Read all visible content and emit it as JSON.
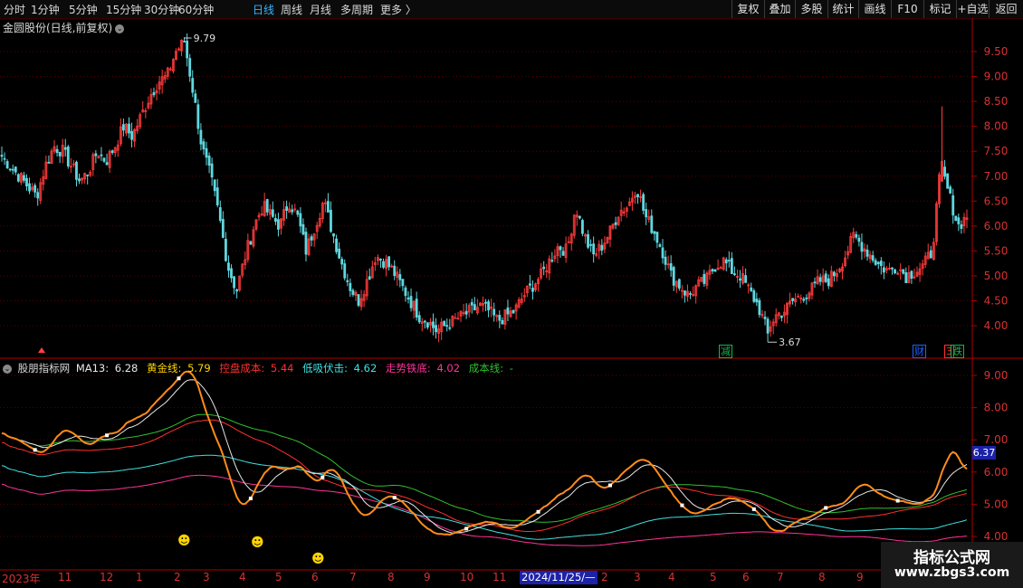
{
  "toolbar": {
    "periods": [
      "分时",
      "1分钟",
      "5分钟",
      "15分钟",
      "30分钟",
      "60分钟",
      "日线",
      "周线",
      "月线",
      "多周期",
      "更多"
    ],
    "active_period": "日线",
    "more_arrow": "〉",
    "buttons": [
      "复权",
      "叠加",
      "多股",
      "统计",
      "画线",
      "F10",
      "标记",
      "+自选",
      "返回"
    ]
  },
  "stock": {
    "title": "金圆股份(日线,前复权)",
    "max_label": "9.79",
    "min_label": "3.67",
    "price_ticks": [
      "9.50",
      "9.00",
      "8.50",
      "8.00",
      "7.50",
      "7.00",
      "6.50",
      "6.00",
      "5.50",
      "5.00",
      "4.50",
      "4.00"
    ],
    "signals": [
      {
        "text": "减",
        "color": "#0fb84a"
      },
      {
        "text": "财",
        "color": "#2060ff"
      },
      {
        "text": "3",
        "color": "#ff3030"
      },
      {
        "text": "跌",
        "color": "#0fb84a"
      }
    ]
  },
  "indicator": {
    "name": "股朋指标网",
    "ma13": {
      "label": "MA13: ",
      "value": "6.28",
      "color": "#e8e8e8"
    },
    "gold": {
      "label": "黄金线: ",
      "value": "5.79",
      "color": "#ffd400"
    },
    "control": {
      "label": "控盘成本: ",
      "value": "5.44",
      "color": "#ff3030"
    },
    "low_buy": {
      "label": "低吸伏击: ",
      "value": "4.62",
      "color": "#40e0e0"
    },
    "bottom": {
      "label": "走势铁底: ",
      "value": "4.02",
      "color": "#ff3399"
    },
    "cost": {
      "label": "成本线: ",
      "value": "-",
      "color": "#30c030"
    },
    "ticks": [
      "9.00",
      "8.00",
      "7.00",
      "6.00",
      "5.00",
      "4.00"
    ],
    "current_value": "6.37",
    "smile_symbol": "☻"
  },
  "date_axis": {
    "labels": [
      "2023年",
      "11",
      "12",
      "1",
      "2",
      "3",
      "4",
      "5",
      "6",
      "7",
      "8",
      "9",
      "10",
      "11",
      "12",
      "2",
      "3",
      "4",
      "5",
      "6",
      "7",
      "8",
      "9",
      "10",
      "11"
    ],
    "cursor_label": "2024/11/25/—"
  },
  "watermark": {
    "title": "指标公式网",
    "url": "www.zbgs3.com"
  },
  "colors": {
    "up": "#ff3b3b",
    "down": "#5fd8e0",
    "axis": "#b00000",
    "grid": "#5a0000"
  },
  "chart_data": {
    "type": "candlestick",
    "period": "daily",
    "price_range": [
      3.5,
      10.0
    ],
    "indicator_range": [
      3.6,
      9.3
    ],
    "ma13": 6.28,
    "gold_line": 5.79,
    "control_cost": 5.44,
    "low_buy_line": 4.62,
    "bottom_line": 4.02,
    "high": 9.79,
    "low": 3.67,
    "series_close": [
      7.4,
      7.2,
      7.0,
      6.8,
      6.6,
      7.2,
      7.6,
      7.5,
      7.2,
      6.9,
      7.1,
      7.5,
      7.3,
      7.6,
      8.0,
      7.8,
      8.2,
      8.6,
      8.9,
      9.0,
      9.5,
      9.7,
      8.7,
      7.6,
      7.0,
      6.2,
      5.2,
      4.7,
      5.4,
      6.0,
      6.4,
      6.2,
      6.0,
      6.5,
      6.2,
      5.5,
      6.0,
      6.5,
      5.9,
      5.3,
      4.8,
      4.5,
      4.9,
      5.4,
      5.3,
      5.1,
      4.8,
      4.5,
      4.2,
      4.1,
      3.9,
      4.0,
      4.1,
      4.2,
      4.3,
      4.4,
      4.3,
      4.1,
      4.2,
      4.3,
      4.6,
      4.8,
      5.0,
      5.3,
      5.6,
      5.5,
      6.4,
      5.8,
      5.4,
      5.6,
      5.9,
      6.3,
      6.4,
      6.8,
      6.2,
      5.9,
      5.5,
      5.0,
      4.8,
      4.6,
      4.8,
      4.9,
      5.2,
      5.3,
      5.1,
      5.0,
      4.7,
      4.4,
      3.9,
      4.2,
      4.3,
      4.5,
      4.6,
      4.7,
      4.9,
      4.9,
      5.1,
      5.4,
      5.8,
      5.6,
      5.4,
      5.2,
      5.1,
      5.2,
      5.0,
      5.1,
      5.2,
      5.5,
      7.2,
      6.6,
      6.0,
      6.2
    ]
  }
}
